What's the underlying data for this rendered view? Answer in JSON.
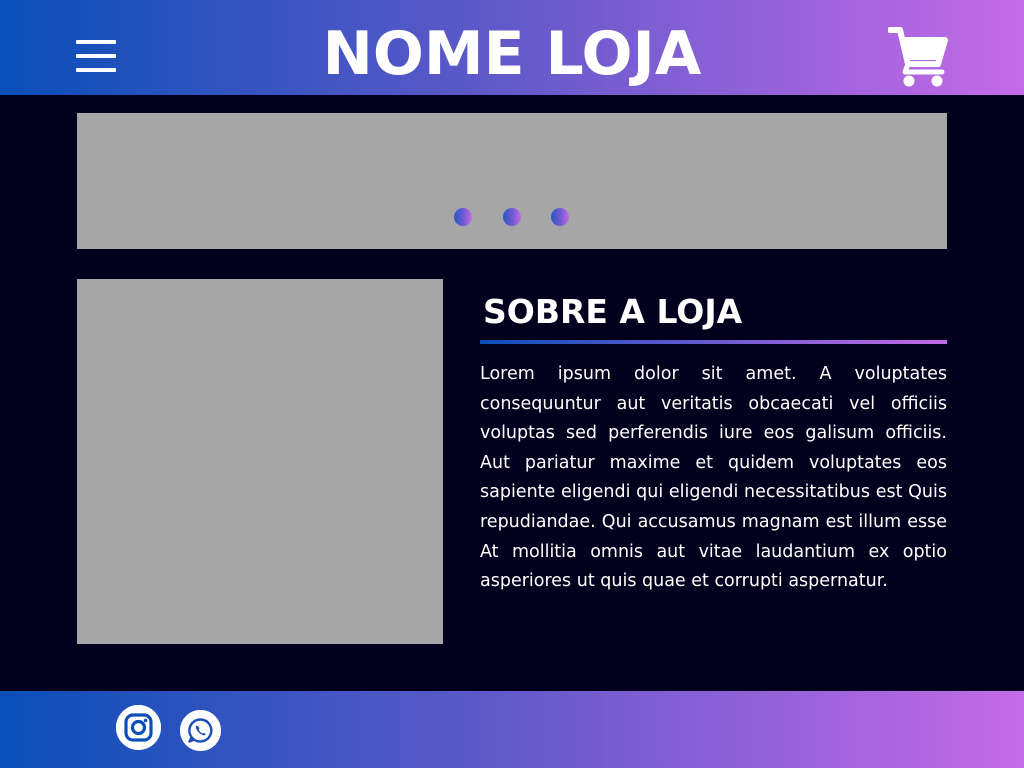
{
  "header": {
    "title": "NOME LOJA",
    "menu_icon": "hamburger-menu-icon",
    "cart_icon": "shopping-cart-icon"
  },
  "banner": {
    "slide_count": 3
  },
  "about": {
    "title": "SOBRE A LOJA",
    "text": "Lorem ipsum dolor sit amet. A voluptates consequuntur aut veritatis obcaecati vel officiis voluptas sed perferendis iure eos galisum officiis. Aut pariatur maxime et quidem voluptates eos sapiente eligendi qui eligendi necessitatibus est Quis repudiandae. Qui accusamus magnam est illum esse At mollitia omnis aut vitae laudantium ex optio asperiores ut quis quae et corrupti aspernatur."
  },
  "footer": {
    "social": [
      "instagram-icon",
      "whatsapp-icon"
    ]
  },
  "colors": {
    "page_background": "#02001c",
    "gradient_start": "#0a4fb8",
    "gradient_end": "#c46ae6",
    "placeholder_gray": "#a6a6a6",
    "text": "#ffffff"
  }
}
